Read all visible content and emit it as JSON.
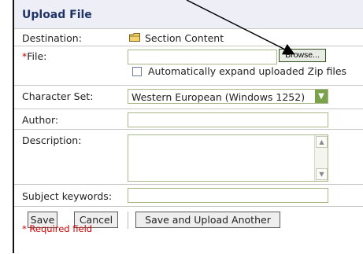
{
  "form": {
    "title": "Upload File",
    "destination": {
      "label": "Destination:",
      "value": "Section Content",
      "icon": "folder-icon"
    },
    "file": {
      "required_mark": "*",
      "label": "File:",
      "value": "",
      "browse_label": "Browse..."
    },
    "auto_expand": {
      "label": "Automatically expand uploaded Zip files",
      "checked": false
    },
    "character_set": {
      "label": "Character Set:",
      "selected": "Western European (Windows 1252)"
    },
    "author": {
      "label": "Author:",
      "value": ""
    },
    "description": {
      "label": "Description:",
      "value": ""
    },
    "subject_keywords": {
      "label": "Subject keywords:",
      "value": ""
    },
    "buttons": {
      "save": "Save",
      "cancel": "Cancel",
      "save_and_upload_another": "Save and Upload Another"
    },
    "required_note": "* Required field"
  },
  "colors": {
    "accent_title": "#1f3466",
    "header_bg": "#eeeef6",
    "required": "#cc0000",
    "input_border": "#a8b88a",
    "select_arrow": "#7aa24a"
  }
}
